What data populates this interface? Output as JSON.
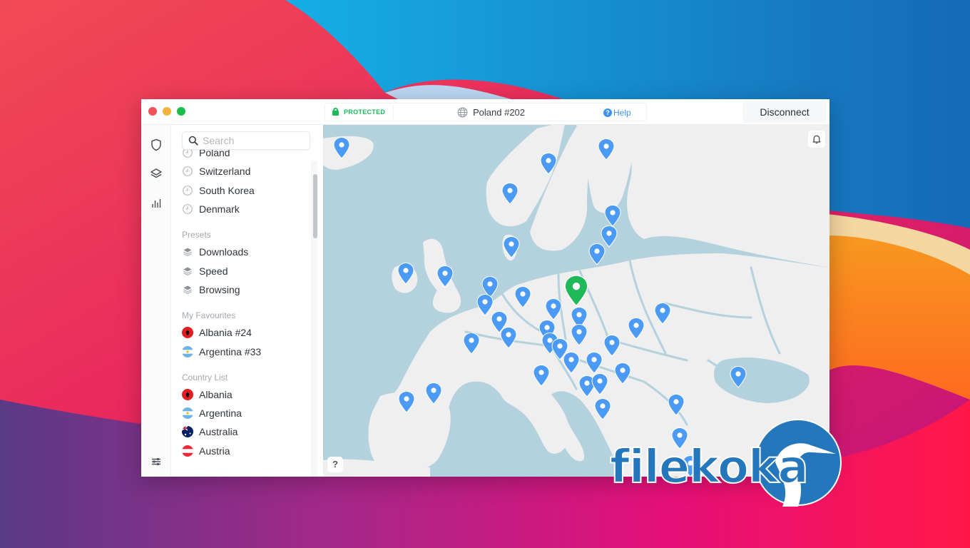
{
  "window": {
    "status": "PROTECTED",
    "server": "Poland #202",
    "help_label": "Help",
    "disconnect_label": "Disconnect"
  },
  "rail": {
    "items": [
      {
        "name": "shield-icon",
        "label": "VPN"
      },
      {
        "name": "layers-icon",
        "label": "Specialty servers"
      },
      {
        "name": "stats-icon",
        "label": "Statistics"
      }
    ],
    "settings_icon": "sliders-icon"
  },
  "sidebar": {
    "search_placeholder": "Search",
    "recents": [
      "Poland",
      "Switzerland",
      "South Korea",
      "Denmark"
    ],
    "presets_title": "Presets",
    "presets": [
      "Downloads",
      "Speed",
      "Browsing"
    ],
    "favourites_title": "My Favourites",
    "favourites": [
      {
        "label": "Albania #24",
        "flag": "albania"
      },
      {
        "label": "Argentina #33",
        "flag": "argentina"
      }
    ],
    "countries_title": "Country List",
    "countries": [
      {
        "label": "Albania",
        "flag": "albania"
      },
      {
        "label": "Argentina",
        "flag": "argentina"
      },
      {
        "label": "Australia",
        "flag": "australia"
      },
      {
        "label": "Austria",
        "flag": "austria"
      }
    ]
  },
  "map": {
    "connected_location": "Poland",
    "pin_color": "#4b9bf5",
    "connected_pin_color": "#1fb95a",
    "help_button": "?",
    "server_pin_count": 40
  },
  "watermark": {
    "text": "filekoka"
  },
  "colors": {
    "protected": "#1cb958",
    "accent": "#3e93f0",
    "sea": "#b4d1de",
    "land": "#efefef"
  }
}
